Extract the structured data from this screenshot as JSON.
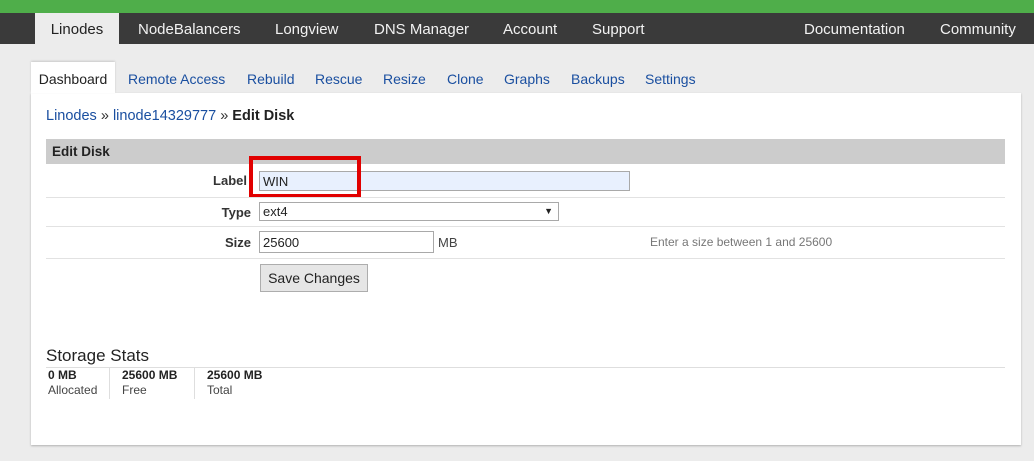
{
  "top_nav": {
    "items": [
      "Linodes",
      "NodeBalancers",
      "Longview",
      "DNS Manager",
      "Account",
      "Support"
    ],
    "right_items": [
      "Documentation",
      "Community"
    ],
    "active": "Linodes"
  },
  "sub_tabs": {
    "items": [
      "Dashboard",
      "Remote Access",
      "Rebuild",
      "Rescue",
      "Resize",
      "Clone",
      "Graphs",
      "Backups",
      "Settings"
    ],
    "active": "Dashboard"
  },
  "breadcrumb": {
    "root": "Linodes",
    "sep1": "»",
    "linode": "linode14329777",
    "sep2": "»",
    "current": "Edit Disk"
  },
  "form": {
    "title": "Edit Disk",
    "label_field": {
      "label": "Label",
      "value": "WIN"
    },
    "type_field": {
      "label": "Type",
      "value": "ext4"
    },
    "size_field": {
      "label": "Size",
      "value": "25600",
      "unit": "MB",
      "hint": "Enter a size between 1 and 25600"
    },
    "save_button": "Save Changes"
  },
  "storage_stats": {
    "title": "Storage Stats",
    "items": [
      {
        "value": "0 MB",
        "label": "Allocated"
      },
      {
        "value": "25600 MB",
        "label": "Free"
      },
      {
        "value": "25600 MB",
        "label": "Total"
      }
    ]
  },
  "colors": {
    "brand_green": "#4fae4a",
    "nav_bg": "#3a3a3a",
    "link_blue": "#1a4fa0",
    "annotation_red": "#e10000"
  }
}
